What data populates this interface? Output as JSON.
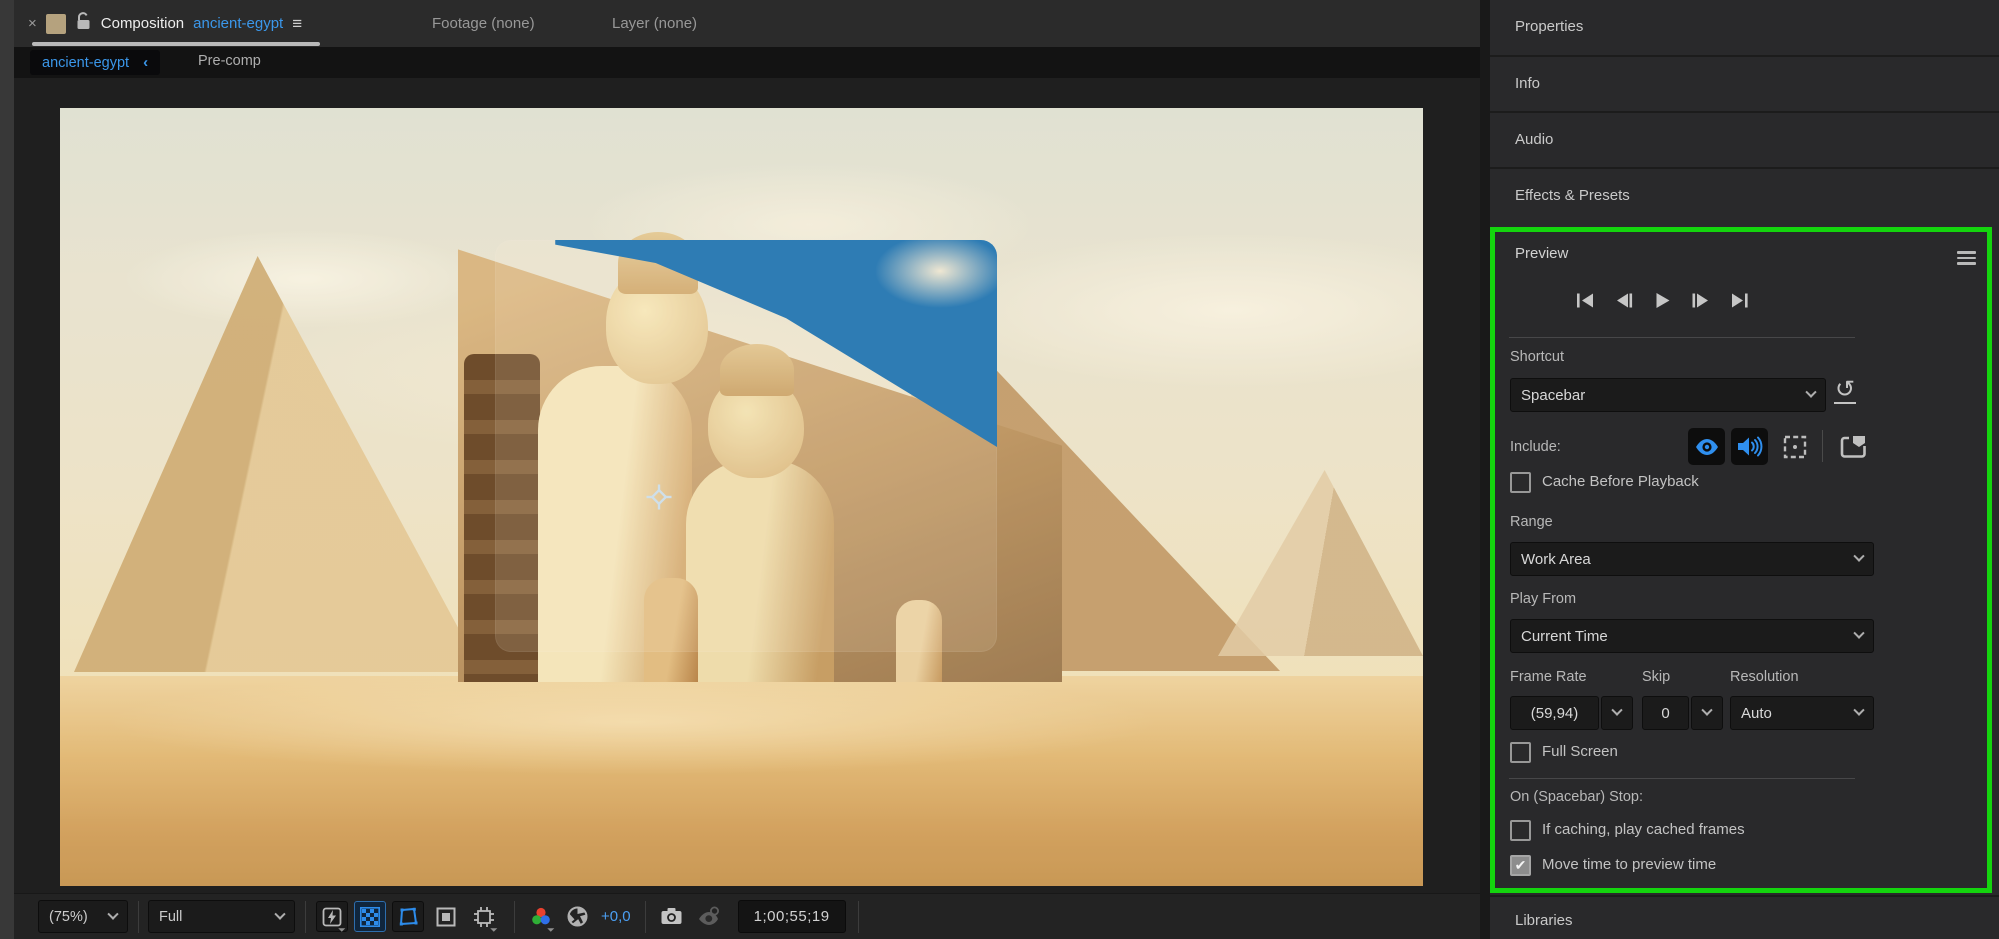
{
  "colors": {
    "accent_blue": "#3b97ea",
    "icon_blue": "#2f8fef",
    "highlight_green": "#14d40e",
    "tab_swatch_tan": "#b5a27e"
  },
  "icons": {
    "close": "×",
    "panel_menu": "≡",
    "breadcrumb_chevron": "‹",
    "reset": "↺",
    "check": "✔"
  },
  "tabs": {
    "composition_label": "Composition",
    "composition_name": "ancient-egypt",
    "footage_tab": "Footage (none)",
    "layer_tab": "Layer (none)"
  },
  "breadcrumb": {
    "current": "ancient-egypt",
    "parent": "Pre-comp"
  },
  "toolbar": {
    "magnification": "(75%)",
    "resolution": "Full",
    "exposure": "+0,0",
    "timecode": "1;00;55;19"
  },
  "right_panel": {
    "items": [
      "Properties",
      "Info",
      "Audio",
      "Effects & Presets"
    ],
    "libraries": "Libraries"
  },
  "preview": {
    "title": "Preview",
    "shortcut_label": "Shortcut",
    "shortcut_value": "Spacebar",
    "include_label": "Include:",
    "cache_label": "Cache Before Playback",
    "range_label": "Range",
    "range_value": "Work Area",
    "play_from_label": "Play From",
    "play_from_value": "Current Time",
    "frame_rate_label": "Frame Rate",
    "frame_rate_value": "(59,94)",
    "skip_label": "Skip",
    "skip_value": "0",
    "resolution_label": "Resolution",
    "resolution_value": "Auto",
    "full_screen_label": "Full Screen",
    "on_stop_label": "On (Spacebar) Stop:",
    "if_caching_label": "If caching, play cached frames",
    "move_time_label": "Move time to preview time",
    "states": {
      "cache_before_playback": false,
      "full_screen": false,
      "if_caching_play_cached": false,
      "move_time_to_preview": true,
      "include_video": true,
      "include_audio": true,
      "include_overlays": false
    }
  }
}
